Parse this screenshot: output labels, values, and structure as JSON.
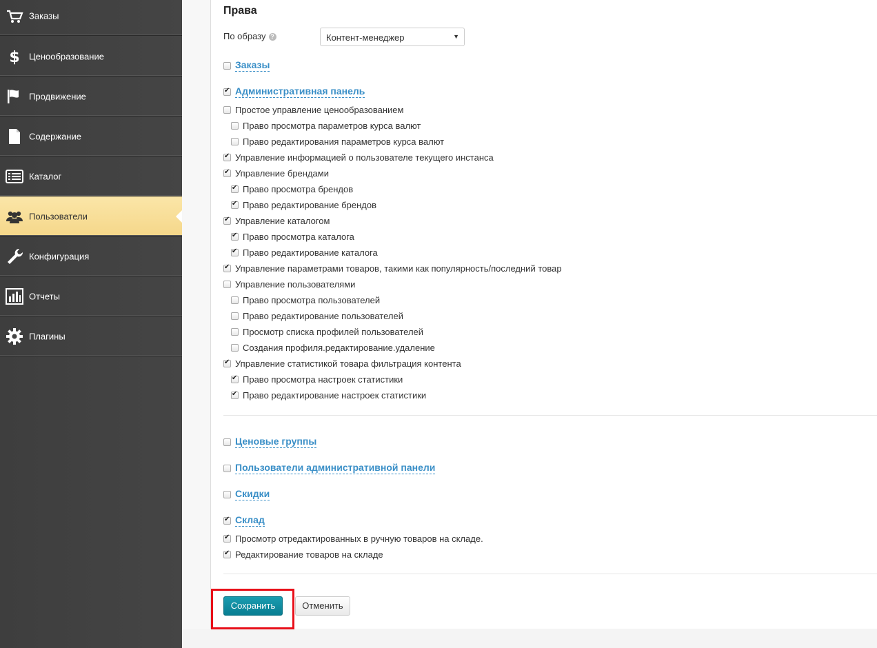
{
  "sidebar": {
    "items": [
      {
        "label": "Заказы",
        "icon": "cart-icon",
        "active": false
      },
      {
        "label": "Ценообразование",
        "icon": "dollar-icon",
        "active": false
      },
      {
        "label": "Продвижение",
        "icon": "flag-icon",
        "active": false
      },
      {
        "label": "Содержание",
        "icon": "document-icon",
        "active": false
      },
      {
        "label": "Каталог",
        "icon": "list-icon",
        "active": false
      },
      {
        "label": "Пользователи",
        "icon": "users-icon",
        "active": true
      },
      {
        "label": "Конфигурация",
        "icon": "wrench-icon",
        "active": false
      },
      {
        "label": "Отчеты",
        "icon": "bar-chart-icon",
        "active": false
      },
      {
        "label": "Плагины",
        "icon": "gear-icon",
        "active": false
      }
    ]
  },
  "rights": {
    "title": "Права",
    "template_label": "По образу",
    "template_value": "Контент-менеджер"
  },
  "permissions": [
    {
      "label": "Заказы",
      "checked": false,
      "group": true
    },
    {
      "label": "Административная панель",
      "checked": true,
      "group": true
    },
    {
      "label": "Простое управление ценообразованием",
      "checked": false,
      "level": 0
    },
    {
      "label": "Право просмотра параметров курса валют",
      "checked": false,
      "level": 1
    },
    {
      "label": "Право редактирования параметров курса валют",
      "checked": false,
      "level": 1
    },
    {
      "label": "Управление информацией о пользователе текущего инстанса",
      "checked": true,
      "level": 0
    },
    {
      "label": "Управление брендами",
      "checked": true,
      "level": 0
    },
    {
      "label": "Право просмотра брендов",
      "checked": true,
      "level": 1
    },
    {
      "label": "Право редактирование брендов",
      "checked": true,
      "level": 1
    },
    {
      "label": "Управление каталогом",
      "checked": true,
      "level": 0
    },
    {
      "label": "Право просмотра каталога",
      "checked": true,
      "level": 1
    },
    {
      "label": "Право редактирование каталога",
      "checked": true,
      "level": 1
    },
    {
      "label": "Управление параметрами товаров, такими как популярность/последний товар",
      "checked": true,
      "level": 0
    },
    {
      "label": "Управление пользователями",
      "checked": false,
      "level": 0
    },
    {
      "label": "Право просмотра пользователей",
      "checked": false,
      "level": 1
    },
    {
      "label": "Право редактирование пользователей",
      "checked": false,
      "level": 1
    },
    {
      "label": "Просмотр списка профилей пользователей",
      "checked": false,
      "level": 1
    },
    {
      "label": "Создания профиля.редактирование.удаление",
      "checked": false,
      "level": 1
    },
    {
      "label": "Управление статистикой товара фильтрация контента",
      "checked": true,
      "level": 0
    },
    {
      "label": "Право просмотра настроек статистики",
      "checked": true,
      "level": 1
    },
    {
      "label": "Право редактирование настроек статистики",
      "checked": true,
      "level": 1
    },
    {
      "label": "Ценовые группы",
      "checked": false,
      "group": true
    },
    {
      "label": "Пользователи административной панели",
      "checked": false,
      "group": true
    },
    {
      "label": "Скидки",
      "checked": false,
      "group": true
    },
    {
      "label": "Склад",
      "checked": true,
      "group": true
    },
    {
      "label": "Просмотр отредактированных в ручную товаров на складе.",
      "checked": true,
      "level": 0
    },
    {
      "label": "Редактирование товаров на складе",
      "checked": true,
      "level": 0
    }
  ],
  "actions": {
    "save_label": "Сохранить",
    "cancel_label": "Отменить"
  },
  "colors": {
    "link": "#3a8fc7",
    "primary_button": "#0b8a9e",
    "highlight": "#e8101a",
    "sidebar_active": "#f8dc92"
  }
}
